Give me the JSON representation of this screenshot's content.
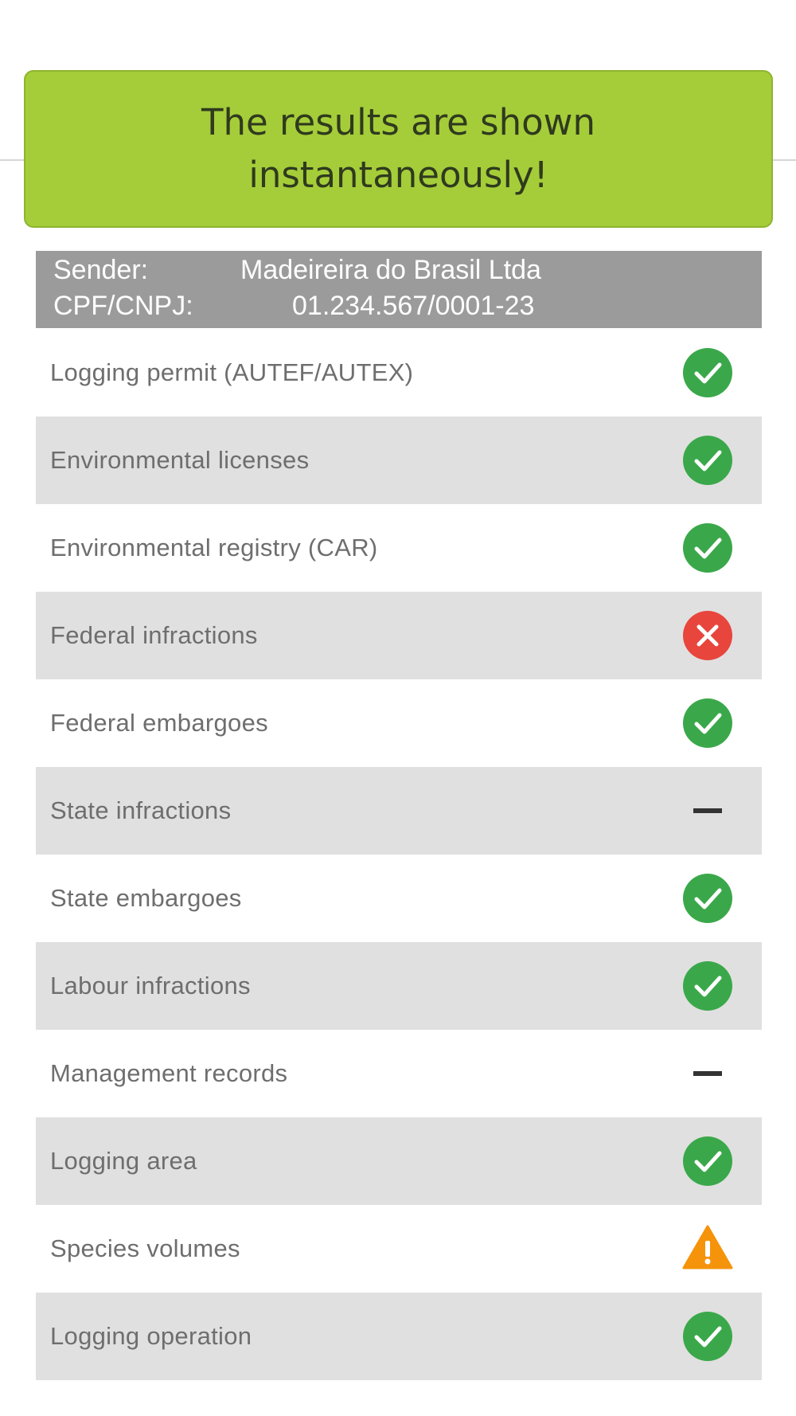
{
  "banner": {
    "message": "The results are shown instantaneously!",
    "background_color": "#a5cd39"
  },
  "sender": {
    "sender_label": "Sender:",
    "sender_value": "Madeireira do Brasil Ltda",
    "cpf_label": "CPF/CNPJ: ",
    "cpf_value": "01.234.567/0001-23"
  },
  "status_colors": {
    "ok": "#3aa84a",
    "fail": "#e8453c",
    "warning": "#f5930a",
    "none": "#333333"
  },
  "checks": [
    {
      "label": "Logging permit (AUTEF/AUTEX)",
      "status": "ok",
      "icon": "check-circle-icon"
    },
    {
      "label": "Environmental licenses",
      "status": "ok",
      "icon": "check-circle-icon"
    },
    {
      "label": "Environmental registry (CAR)",
      "status": "ok",
      "icon": "check-circle-icon"
    },
    {
      "label": "Federal infractions",
      "status": "fail",
      "icon": "x-circle-icon"
    },
    {
      "label": "Federal embargoes",
      "status": "ok",
      "icon": "check-circle-icon"
    },
    {
      "label": "State infractions",
      "status": "none",
      "icon": "dash-icon"
    },
    {
      "label": "State embargoes",
      "status": "ok",
      "icon": "check-circle-icon"
    },
    {
      "label": "Labour infractions",
      "status": "ok",
      "icon": "check-circle-icon"
    },
    {
      "label": "Management records",
      "status": "none",
      "icon": "dash-icon"
    },
    {
      "label": "Logging area",
      "status": "ok",
      "icon": "check-circle-icon"
    },
    {
      "label": "Species volumes",
      "status": "warning",
      "icon": "warning-triangle-icon"
    },
    {
      "label": "Logging operation",
      "status": "ok",
      "icon": "check-circle-icon"
    }
  ]
}
